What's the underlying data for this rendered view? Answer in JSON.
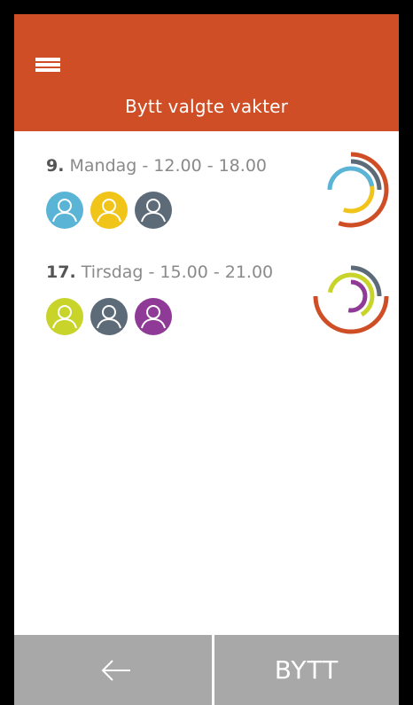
{
  "header": {
    "title": "Bytt valgte vakter",
    "menu_icon": "hamburger-menu-icon",
    "background": "#cf4e25"
  },
  "shifts": [
    {
      "day": "9.",
      "rest": " Mandag - 12.00 - 18.00",
      "avatars": [
        {
          "color": "#5ab4d6"
        },
        {
          "color": "#f0c419"
        },
        {
          "color": "#5d6b78"
        }
      ],
      "ring_colors": [
        "#cf4e25",
        "#5d6b78",
        "#f0c419",
        "#5ab4d6"
      ]
    },
    {
      "day": "17.",
      "rest": " Tirsdag - 15.00 - 21.00",
      "avatars": [
        {
          "color": "#c8d42a"
        },
        {
          "color": "#5d6b78"
        },
        {
          "color": "#8e3a96"
        }
      ],
      "ring_colors": [
        "#cf4e25",
        "#5d6b78",
        "#c8d42a",
        "#8e3a96"
      ]
    }
  ],
  "footer": {
    "back_icon": "arrow-left-icon",
    "swap_label": "BYTT",
    "background": "#a8a8a8"
  }
}
